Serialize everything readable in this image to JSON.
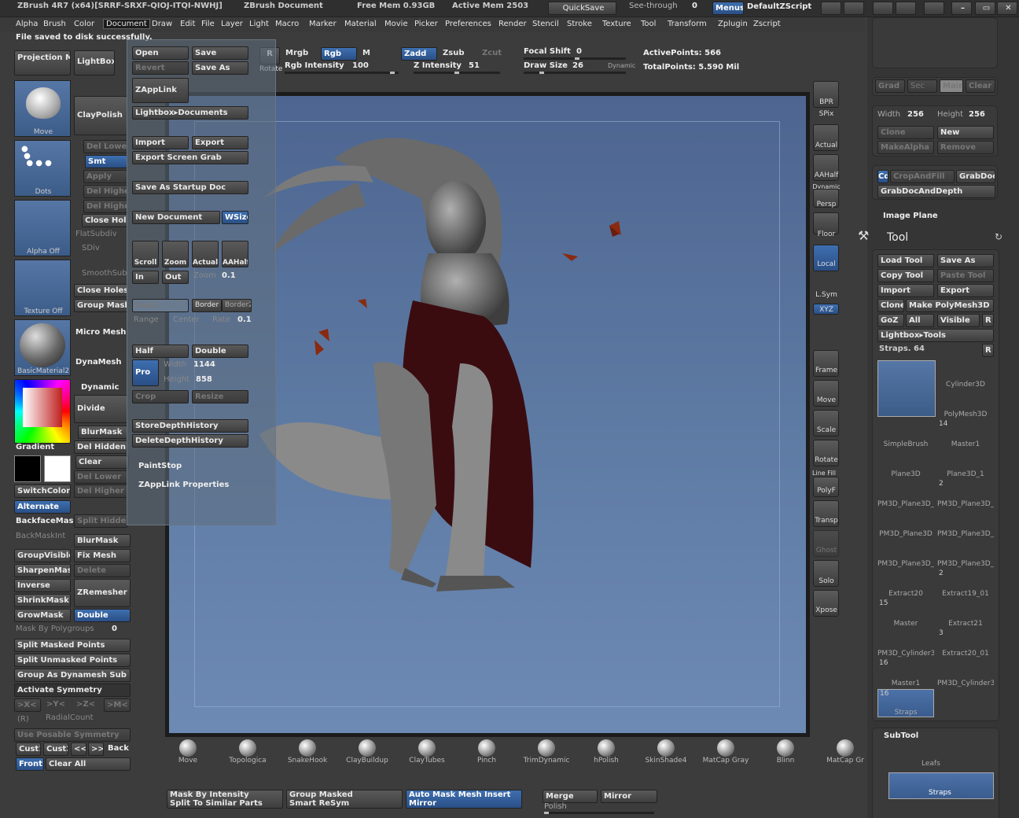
{
  "titlebar": {
    "title": "ZBrush 4R7 (x64)[SRRF-SRXF-QIOJ-ITQI-NWHJ]",
    "doc": "ZBrush Document",
    "free_mem": "Free Mem 0.93GB",
    "active_mem": "Active Mem 2503",
    "quicksave": "QuickSave",
    "seethrough": "See-through",
    "seethrough_val": "0",
    "menus": "Menus",
    "script": "DefaultZScript"
  },
  "menus": [
    "Alpha",
    "Brush",
    "Color",
    "Document",
    "Draw",
    "Edit",
    "File",
    "Layer",
    "Light",
    "Macro",
    "Marker",
    "Material",
    "Movie",
    "Picker",
    "Preferences",
    "Render",
    "Stencil",
    "Stroke",
    "Texture",
    "Tool",
    "Transform",
    "Zplugin",
    "Zscript"
  ],
  "notice": "File saved to disk successfully.",
  "top_shelf": {
    "mrgb": "Mrgb",
    "rgb": "Rgb",
    "m": "M",
    "zadd": "Zadd",
    "zsub": "Zsub",
    "zcut": "Zcut",
    "rgb_intensity": "Rgb Intensity",
    "rgb_intensity_val": "100",
    "z_intensity": "Z Intensity",
    "z_intensity_val": "51",
    "focal_shift": "Focal Shift",
    "focal_shift_val": "0",
    "draw_size": "Draw Size",
    "draw_size_val": "26",
    "dynamic": "Dynamic",
    "active_points": "ActivePoints: 566",
    "total_points": "TotalPoints: 5.590 Mil",
    "rotate": "Rotate"
  },
  "left": {
    "projection_master": "Projection Master",
    "lightbox": "LightBox",
    "move": "Move",
    "claypolish": "ClayPolish",
    "dots": "Dots",
    "alpha_off": "Alpha Off",
    "texture_off": "Texture Off",
    "material": "BasicMaterial2",
    "del_lower": "Del Lower",
    "smt": "Smt",
    "apply": "Apply",
    "del_higher": "Del Higher",
    "del_higher2": "Del Higher",
    "close_holes_short": "Close Hol",
    "flatsubdiv": "FlatSubdiv",
    "sdiv": "SDiv",
    "smoothsub": "SmoothSub",
    "close_holes": "Close Holes",
    "group_masks": "Group Masks",
    "micro_mesh": "Micro Mesh",
    "dynamesh": "DynaMesh",
    "dynamic": "Dynamic",
    "divide": "Divide",
    "blurmask_top": "BlurMask",
    "del_hidden": "Del Hidden",
    "clear": "Clear",
    "del_lower2": "Del Lower",
    "del_higher3": "Del Higher",
    "gradient": "Gradient",
    "switchcolor": "SwitchColor",
    "alternate": "Alternate",
    "backfacemask": "BackfaceMask",
    "backfacemaskint": "BackMaskInt",
    "split_hidden": "Split Hidden",
    "blurmask": "BlurMask",
    "groupvisible": "GroupVisible",
    "fix_mesh": "Fix Mesh",
    "sharpenmask": "SharpenMask",
    "delete": "Delete",
    "inverse": "Inverse",
    "zremesher": "ZRemesher",
    "shrinkmask": "ShrinkMask",
    "growmask": "GrowMask",
    "double": "Double",
    "mask_by_polygroups": "Mask By Polygroups",
    "mask_by_polygroups_val": "0",
    "split_masked": "Split Masked Points",
    "split_unmasked": "Split Unmasked Points",
    "group_as_dynamesh": "Group As Dynamesh Sub",
    "activate_symmetry": "Activate Symmetry",
    "sym_x": ">X<",
    "sym_y": ">Y<",
    "sym_z": ">Z<",
    "sym_m": ">M<",
    "r": "(R)",
    "radialcount": "RadialCount",
    "use_posable": "Use Posable Symmetry",
    "cust1": "Cust1",
    "cust2": "Cust2",
    "back": "Back",
    "front": "Front",
    "clear_all": "Clear All",
    "paintstop": "PaintStop",
    "zapplink_props": "ZAppLink Properties"
  },
  "docmenu": {
    "open": "Open",
    "save": "Save",
    "revert": "Revert",
    "save_as": "Save As",
    "zapplink": "ZAppLink",
    "lightbox_docs": "Lightbox▸Documents",
    "import": "Import",
    "export": "Export",
    "export_screen": "Export Screen Grab",
    "save_startup": "Save As Startup Doc",
    "new_doc": "New Document",
    "wsize": "WSize",
    "scroll": "Scroll",
    "zoom": "Zoom",
    "actual": "Actual",
    "aahalf": "AAHalf",
    "in": "In",
    "out": "Out",
    "zoom_lbl": "Zoom",
    "zoom_val": "0.1",
    "back": "Back",
    "border": "Border",
    "border2": "Border2",
    "range": "Range",
    "center": "Center",
    "rate": "Rate",
    "rate_val": "0.1",
    "half": "Half",
    "double": "Double",
    "pro": "Pro",
    "width": "Width",
    "width_val": "1144",
    "height": "Height",
    "height_val": "858",
    "crop": "Crop",
    "resize": "Resize",
    "store_depth": "StoreDepthHistory",
    "delete_depth": "DeleteDepthHistory"
  },
  "right_tools": {
    "bpr": "BPR",
    "spix": "SPix",
    "actual": "Actual",
    "aahalf": "AAHalf",
    "dynamic": "Dynamic",
    "persp": "Persp",
    "floor": "Floor",
    "local": "Local",
    "lsym": "L.Sym",
    "xyz": "XYZ",
    "frame": "Frame",
    "move": "Move",
    "scale": "Scale",
    "rotate": "Rotate",
    "linefill": "Line Fill",
    "polyf": "PolyF",
    "transp": "Transp",
    "ghost": "Ghost",
    "solo": "Solo",
    "xpose": "Xpose"
  },
  "right_panel": {
    "grad": "Grad",
    "sec": "Sec",
    "main": "Main",
    "clear": "Clear",
    "width": "Width",
    "width_val": "256",
    "height": "Height",
    "height_val": "256",
    "clone": "Clone",
    "new": "New",
    "makealpha": "MakeAlpha",
    "remove": "Remove",
    "cd": "Cd",
    "cropandfill": "CropAndFill",
    "grabdoc": "GrabDoc",
    "grabdocanddepth": "GrabDocAndDepth",
    "image_plane": "Image Plane",
    "tool": "Tool",
    "load_tool": "Load Tool",
    "save_as": "Save As",
    "copy_tool": "Copy Tool",
    "paste_tool": "Paste Tool",
    "import": "Import",
    "export": "Export",
    "make_polymesh": "Make PolyMesh3D",
    "goz": "GoZ",
    "all": "All",
    "visible": "Visible",
    "r": "R",
    "lightbox_tools": "Lightbox▸Tools",
    "straps": "Straps. 64",
    "tiles": [
      {
        "name": "Straps",
        "num": "16"
      },
      {
        "name": "Cylinder3D",
        "num": ""
      },
      {
        "name": "",
        "num": ""
      },
      {
        "name": "PolyMesh3D",
        "num": ""
      },
      {
        "name": "SimpleBrush",
        "num": ""
      },
      {
        "name": "Master1",
        "num": "14"
      },
      {
        "name": "Plane3D",
        "num": ""
      },
      {
        "name": "Plane3D_1",
        "num": ""
      },
      {
        "name": "PM3D_Plane3D_",
        "num": ""
      },
      {
        "name": "PM3D_Plane3D_",
        "num": "2"
      },
      {
        "name": "PM3D_Plane3D",
        "num": ""
      },
      {
        "name": "PM3D_Plane3D_",
        "num": ""
      },
      {
        "name": "PM3D_Plane3D_",
        "num": ""
      },
      {
        "name": "PM3D_Plane3D_",
        "num": ""
      },
      {
        "name": "Extract20",
        "num": ""
      },
      {
        "name": "Extract19_01",
        "num": "2"
      },
      {
        "name": "Master",
        "num": "15"
      },
      {
        "name": "Extract21",
        "num": ""
      },
      {
        "name": "PM3D_Cylinder3",
        "num": ""
      },
      {
        "name": "Extract20_01",
        "num": "3"
      },
      {
        "name": "Master1",
        "num": "16"
      },
      {
        "name": "PM3D_Cylinder3",
        "num": ""
      },
      {
        "name": "Straps",
        "num": "16"
      }
    ],
    "subtool": "SubTool",
    "leafs": "Leafs",
    "straps_sub": "Straps"
  },
  "bottom_shelf": {
    "brushes": [
      "Move",
      "Topologica",
      "SnakeHook",
      "ClayBuildup",
      "ClayTubes",
      "Pinch",
      "TrimDynamic",
      "hPolish",
      "SkinShade4",
      "MatCap Gray",
      "Blinn",
      "MatCap Gr"
    ],
    "mask_by_intensity": "Mask By Intensity",
    "split_similar": "Split To Similar Parts",
    "group_masked": "Group Masked",
    "smart_resym": "Smart ReSym",
    "auto_mask": "Auto Mask Mesh Insert",
    "mirror_btn": "Mirror",
    "merge": "Merge",
    "mirror": "Mirror",
    "polish": "Polish"
  }
}
